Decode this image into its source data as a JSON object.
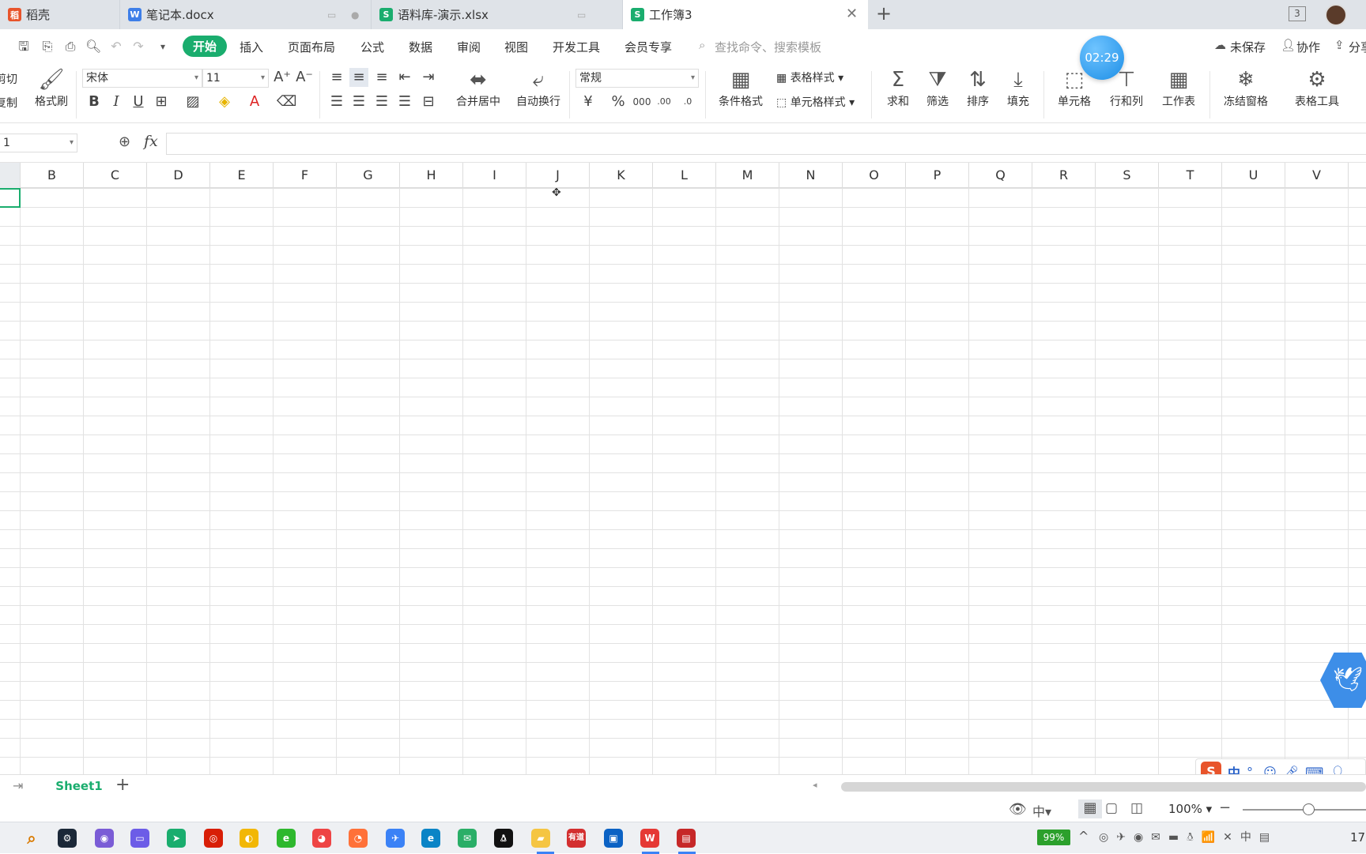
{
  "tabs": [
    {
      "label": "稻壳",
      "icon": "daoke-icon",
      "color": "#e8542b"
    },
    {
      "label": "笔记本.docx",
      "icon": "word-doc-icon",
      "color": "#3d7ee8"
    },
    {
      "label": "语料库-演示.xlsx",
      "icon": "sheet-icon",
      "color": "#1aad6e"
    },
    {
      "label": "工作簿3",
      "icon": "sheet-icon",
      "color": "#1aad6e"
    }
  ],
  "tab_extras": {
    "window_count": "3"
  },
  "menu": {
    "items": [
      "开始",
      "插入",
      "页面布局",
      "公式",
      "数据",
      "审阅",
      "视图",
      "开发工具",
      "会员专享"
    ],
    "search_placeholder": "查找命令、搜索模板",
    "timer": "02:29",
    "unsaved": "未保存",
    "collab": "协作",
    "share": "分享"
  },
  "ribbon": {
    "cut": "剪切",
    "copy": "复制",
    "format_painter": "格式刷",
    "font_name": "宋体",
    "font_size": "11",
    "merge_center": "合并居中",
    "wrap_text": "自动换行",
    "number_format": "常规",
    "conditional_format": "条件格式",
    "table_style": "表格样式",
    "cell_style": "单元格样式",
    "sum": "求和",
    "filter": "筛选",
    "sort": "排序",
    "fill": "填充",
    "cell": "单元格",
    "row_col": "行和列",
    "worksheet": "工作表",
    "freeze": "冻结窗格",
    "table_tools": "表格工具"
  },
  "formula_bar": {
    "name_box": "1",
    "fx": "fx",
    "formula": ""
  },
  "columns": [
    "B",
    "C",
    "D",
    "E",
    "F",
    "G",
    "H",
    "I",
    "J",
    "K",
    "L",
    "M",
    "N",
    "O",
    "P",
    "Q",
    "R",
    "S",
    "T",
    "U",
    "V"
  ],
  "sheets": {
    "active": "Sheet1"
  },
  "status": {
    "zoom": "100%",
    "battery": "99%",
    "ime": "中",
    "clock": "17"
  },
  "accent": "#1aad6e"
}
